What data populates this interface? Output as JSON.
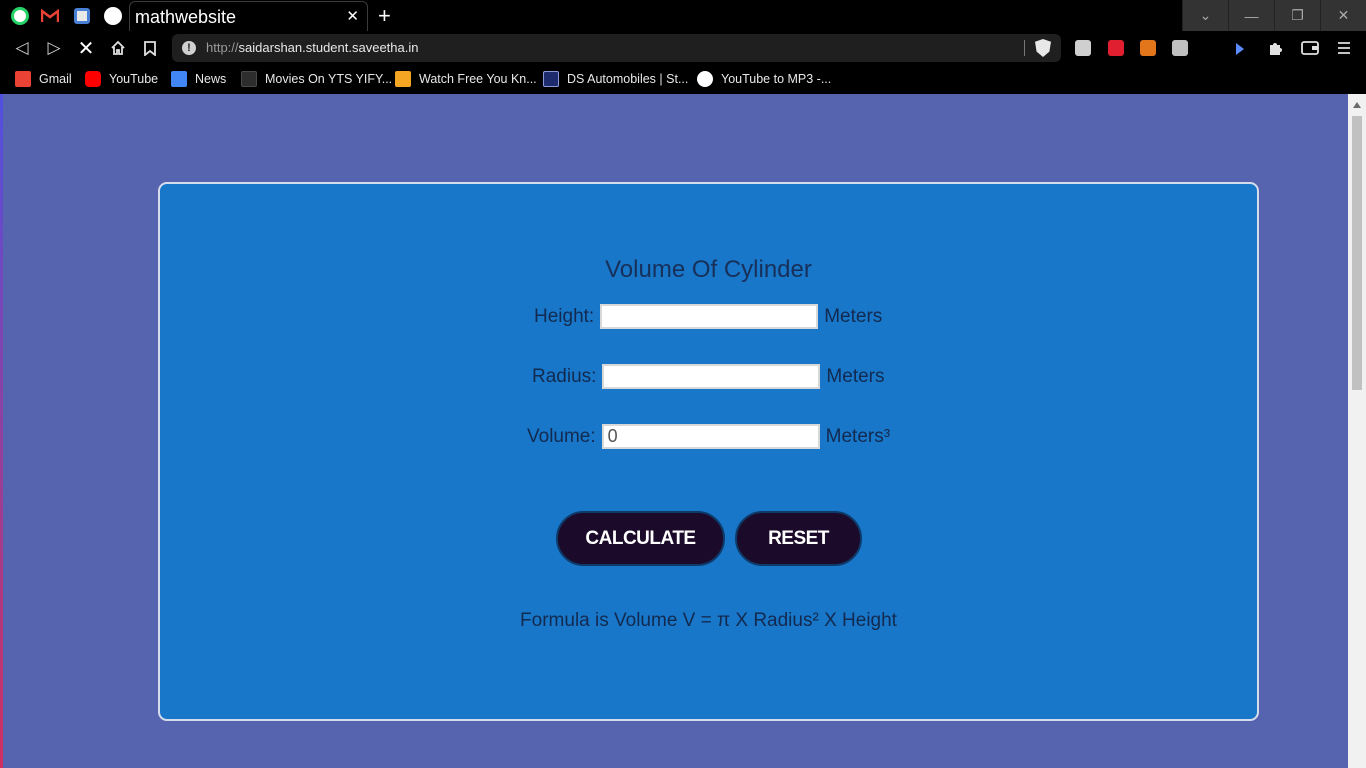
{
  "browser": {
    "tab_title": "mathwebsite",
    "close_glyph": "✕",
    "new_tab_glyph": "+",
    "url_scheme": "http://",
    "url_host": "saidarshan.student.saveetha.in",
    "window_controls": [
      "⌄",
      "—",
      "❐",
      "✕"
    ],
    "bookmarks": [
      {
        "label": "Gmail",
        "color": "#ea4335"
      },
      {
        "label": "YouTube",
        "color": "#ff0000"
      },
      {
        "label": "News",
        "color": "#4285f4"
      },
      {
        "label": "Movies On YTS YIFY...",
        "color": "#2d2d2d"
      },
      {
        "label": "Watch Free You Kn...",
        "color": "#f5a623"
      },
      {
        "label": "DS Automobiles | St...",
        "color": "#1d2a6b"
      },
      {
        "label": "YouTube to MP3 -...",
        "color": "#ffffff"
      }
    ]
  },
  "page": {
    "heading": "Volume Of Cylinder",
    "height_label": "Height:",
    "height_value": "",
    "height_unit": "Meters",
    "radius_label": "Radius:",
    "radius_value": "",
    "radius_unit": "Meters",
    "volume_label": "Volume:",
    "volume_value": "0",
    "volume_unit": "Meters³",
    "calculate_label": "CALCULATE",
    "reset_label": "RESET",
    "formula": "Formula is Volume V = π X Radius² X Height"
  },
  "colors": {
    "page_bg": "#5664b0",
    "card_bg": "#1877c8",
    "button_bg": "#1b0a2a"
  }
}
